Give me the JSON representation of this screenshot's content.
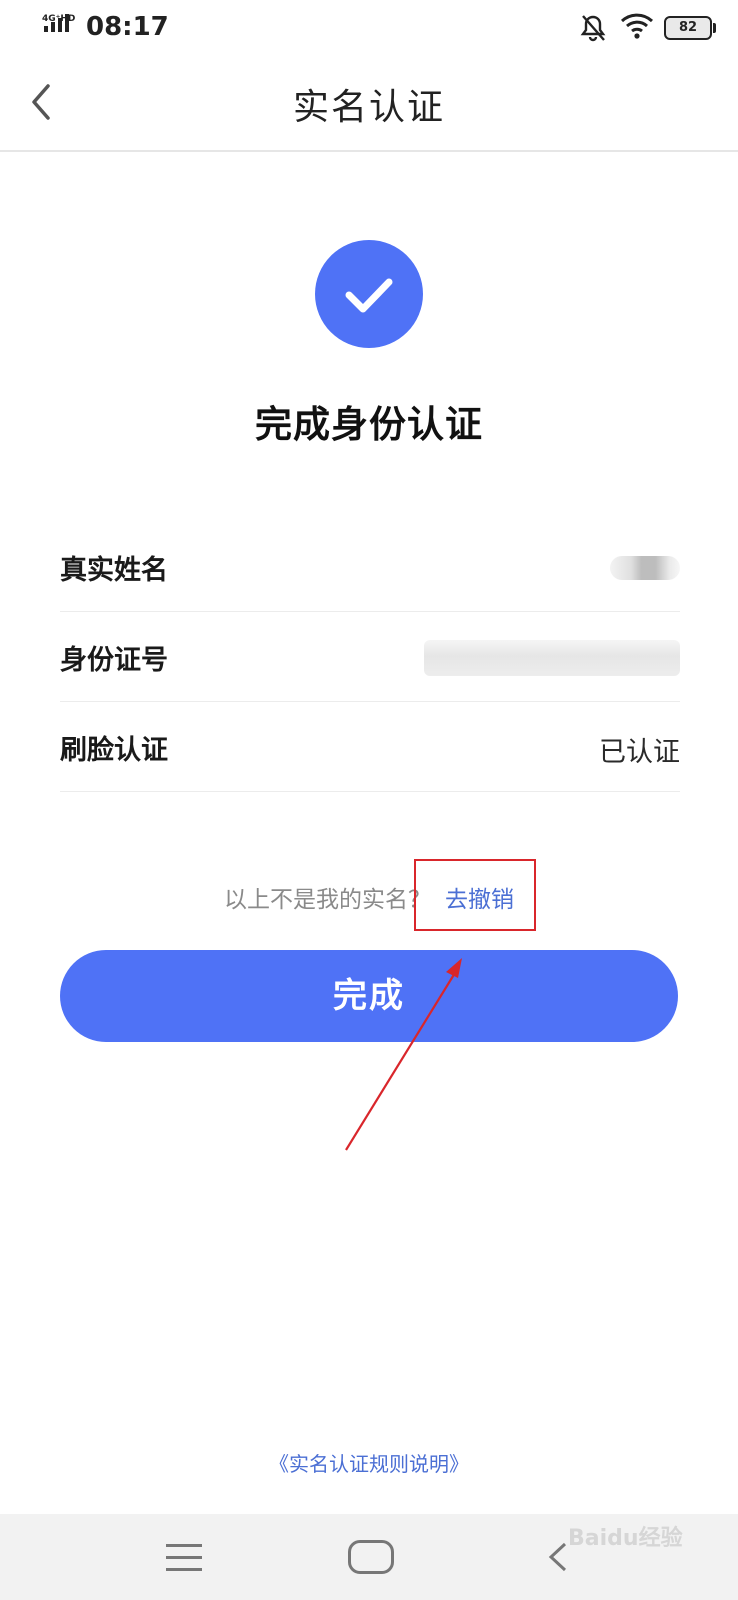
{
  "status_bar": {
    "network": "4G⁺HD",
    "time": "08:17",
    "battery": "82",
    "icons": [
      "signal-icon",
      "bell-off-icon",
      "wifi-icon",
      "battery-icon"
    ]
  },
  "nav": {
    "title": "实名认证",
    "back_icon": "chevron-left-icon"
  },
  "success": {
    "icon": "check-icon",
    "title": "完成身份认证",
    "accent": "#4f72f6"
  },
  "info": {
    "rows": [
      {
        "label": "真实姓名",
        "value": ""
      },
      {
        "label": "身份证号",
        "value": ""
      },
      {
        "label": "刷脸认证",
        "value": "已认证"
      }
    ]
  },
  "revoke": {
    "text": "以上不是我的实名？",
    "link": "去撤销",
    "link_color": "#4b6fd4"
  },
  "done_button": {
    "label": "完成"
  },
  "footer": {
    "rules_link": "《实名认证规则说明》"
  },
  "system_nav": {
    "menu_icon": "menu-icon",
    "home_icon": "home-icon",
    "back_icon": "back-icon"
  },
  "watermark": "Baidu经验",
  "annotation": {
    "highlight_color": "#d9262b"
  }
}
